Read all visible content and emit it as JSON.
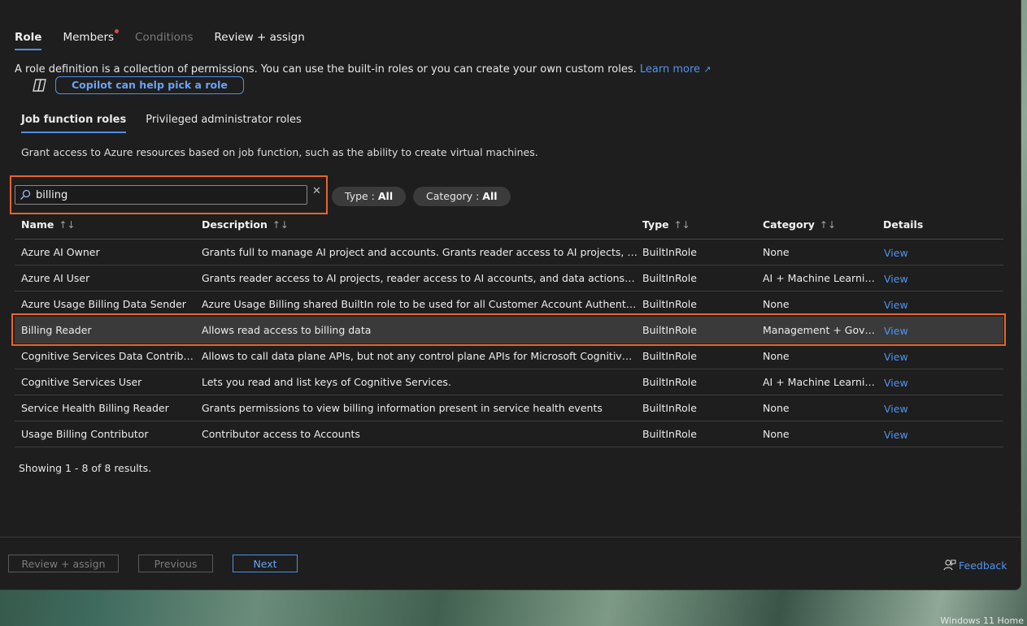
{
  "tabs": [
    "Role",
    "Members",
    "Conditions",
    "Review + assign"
  ],
  "intro": {
    "text": "A role definition is a collection of permissions. You can use the built-in roles or you can create your own custom roles.",
    "learn_more": "Learn more"
  },
  "copilot": {
    "label": "Copilot can help pick a role"
  },
  "subtabs": [
    "Job function roles",
    "Privileged administrator roles"
  ],
  "subtab_desc": "Grant access to Azure resources based on job function, such as the ability to create virtual machines.",
  "search": {
    "value": "billing"
  },
  "filters": {
    "type": {
      "label": "Type : ",
      "value": "All"
    },
    "category": {
      "label": "Category : ",
      "value": "All"
    }
  },
  "table": {
    "headers": [
      "Name",
      "Description",
      "Type",
      "Category",
      "Details"
    ],
    "sort_glyph": "↑↓",
    "rows": [
      {
        "name": "Azure AI Owner",
        "description": "Grants full to manage AI project and accounts. Grants reader access to AI projects, reader a...",
        "type": "BuiltInRole",
        "category": "None",
        "details": "View"
      },
      {
        "name": "Azure AI User",
        "description": "Grants reader access to AI projects, reader access to AI accounts, and data actions for an AI ...",
        "type": "BuiltInRole",
        "category": "AI + Machine Learning",
        "details": "View"
      },
      {
        "name": "Azure Usage Billing Data Sender",
        "description": "Azure Usage Billing shared BuiltIn role to be used for all Customer Account Authentication",
        "type": "BuiltInRole",
        "category": "None",
        "details": "View"
      },
      {
        "name": "Billing Reader",
        "description": "Allows read access to billing data",
        "type": "BuiltInRole",
        "category": "Management + Gover...",
        "details": "View"
      },
      {
        "name": "Cognitive Services Data Contributor...",
        "description": "Allows to call data plane APIs, but not any control plane APIs for Microsoft Cognitive Servic...",
        "type": "BuiltInRole",
        "category": "None",
        "details": "View"
      },
      {
        "name": "Cognitive Services User",
        "description": "Lets you read and list keys of Cognitive Services.",
        "type": "BuiltInRole",
        "category": "AI + Machine Learning",
        "details": "View"
      },
      {
        "name": "Service Health Billing Reader",
        "description": "Grants permissions to view billing information present in service health events",
        "type": "BuiltInRole",
        "category": "None",
        "details": "View"
      },
      {
        "name": "Usage Billing Contributor",
        "description": "Contributor access to Accounts",
        "type": "BuiltInRole",
        "category": "None",
        "details": "View"
      }
    ]
  },
  "showing": "Showing 1 - 8 of 8 results.",
  "footer": {
    "review": "Review + assign",
    "previous": "Previous",
    "next": "Next",
    "feedback": "Feedback"
  },
  "os_label": "Windows 11 Home",
  "colors": {
    "accent": "#4f8fe8",
    "highlight": "#e8642a",
    "link": "#4f94ef",
    "panel_bg": "#1e1e1e"
  }
}
